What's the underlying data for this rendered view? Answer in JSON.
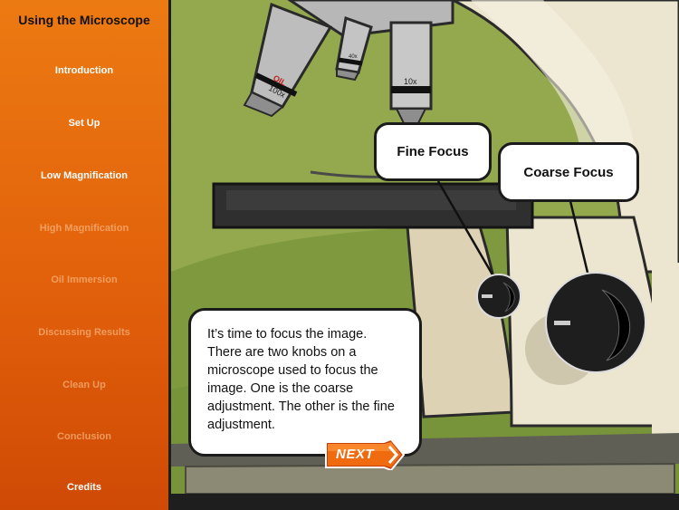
{
  "app": {
    "title": "Using the Microscope"
  },
  "nav": {
    "items": [
      {
        "label": "Introduction",
        "state": "active"
      },
      {
        "label": "Set Up",
        "state": "active"
      },
      {
        "label": "Low Magnification",
        "state": "active"
      },
      {
        "label": "High Magnification",
        "state": "inactive"
      },
      {
        "label": "Oil Immersion",
        "state": "inactive"
      },
      {
        "label": "Discussing Results",
        "state": "inactive"
      },
      {
        "label": "Clean Up",
        "state": "inactive"
      },
      {
        "label": "Conclusion",
        "state": "inactive"
      },
      {
        "label": "Credits",
        "state": "active"
      }
    ]
  },
  "scene": {
    "objectives": {
      "oil_label": "OIL",
      "high": "100x",
      "mid": "40x",
      "low": "10x"
    },
    "labels": {
      "fine_focus": "Fine Focus",
      "coarse_focus": "Coarse Focus"
    }
  },
  "instruction": {
    "text": "It’s time to focus the image. There are two knobs on a microscope used to focus the image. One is the coarse adjustment. The other is the fine adjustment."
  },
  "next_button": {
    "label": "NEXT"
  },
  "colors": {
    "sidebar_orange": "#e2610b",
    "background_green": "#94a94e",
    "button_orange": "#f06a10"
  }
}
